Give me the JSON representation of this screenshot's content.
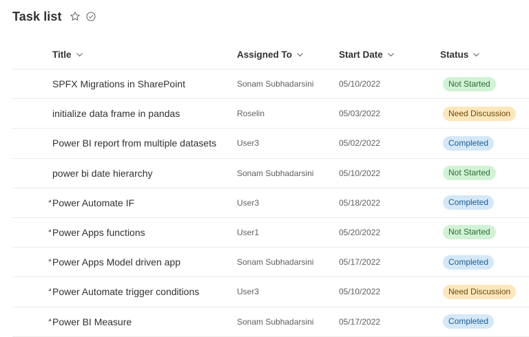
{
  "page": {
    "title": "Task list"
  },
  "header_icons": {
    "favorite": "star-icon",
    "follow": "check-circle-icon"
  },
  "columns": {
    "title": "Title",
    "assigned_to": "Assigned To",
    "start_date": "Start Date",
    "status": "Status"
  },
  "rows": [
    {
      "title": "SPFX Migrations in SharePoint",
      "assigned_to": "Sonam Subhadarsini",
      "start_date": "05/10/2022",
      "status": "Not Started",
      "is_new": false
    },
    {
      "title": "initialize data frame in pandas",
      "assigned_to": "Roselin",
      "start_date": "05/03/2022",
      "status": "Need Discussion",
      "is_new": false
    },
    {
      "title": "Power BI report from multiple datasets",
      "assigned_to": "User3",
      "start_date": "05/02/2022",
      "status": "Completed",
      "is_new": false
    },
    {
      "title": "power bi date hierarchy",
      "assigned_to": "Sonam Subhadarsini",
      "start_date": "05/10/2022",
      "status": "Not Started",
      "is_new": false
    },
    {
      "title": "Power Automate IF",
      "assigned_to": "User3",
      "start_date": "05/18/2022",
      "status": "Completed",
      "is_new": true
    },
    {
      "title": "Power Apps functions",
      "assigned_to": "User1",
      "start_date": "05/20/2022",
      "status": "Not Started",
      "is_new": true
    },
    {
      "title": "Power Apps Model driven app",
      "assigned_to": "Sonam Subhadarsini",
      "start_date": "05/17/2022",
      "status": "Completed",
      "is_new": true
    },
    {
      "title": "Power Automate trigger conditions",
      "assigned_to": "User3",
      "start_date": "05/10/2022",
      "status": "Need Discussion",
      "is_new": true
    },
    {
      "title": "Power BI Measure",
      "assigned_to": "Sonam Subhadarsini",
      "start_date": "05/17/2022",
      "status": "Completed",
      "is_new": true
    }
  ],
  "status_colors": {
    "Not Started": {
      "bg": "#d1f3d5",
      "fg": "#2d6a34"
    },
    "Need Discussion": {
      "bg": "#fde7bd",
      "fg": "#6b4a07"
    },
    "Completed": {
      "bg": "#d4e8f8",
      "fg": "#1b5d94"
    }
  }
}
